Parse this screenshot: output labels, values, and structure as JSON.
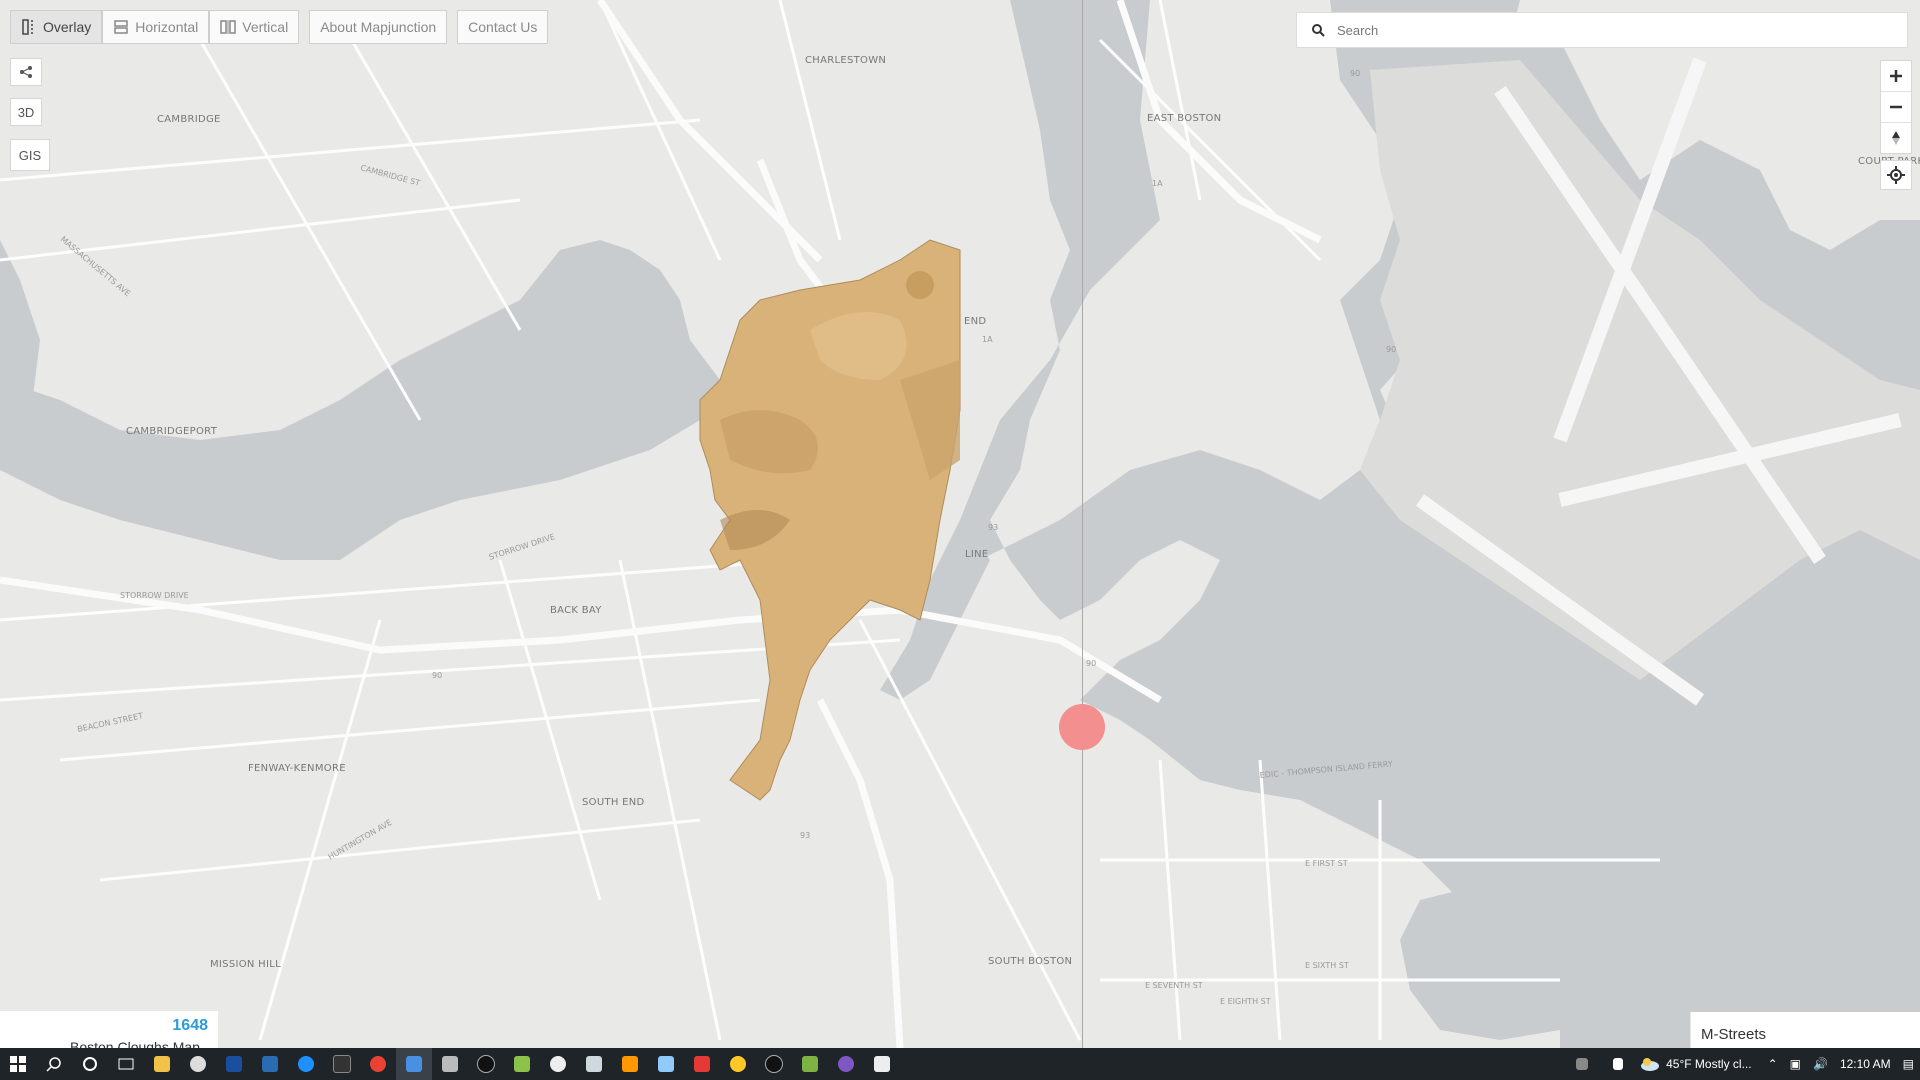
{
  "toolbar": {
    "overlay": "Overlay",
    "horizontal": "Horizontal",
    "vertical": "Vertical",
    "about": "About Mapjunction",
    "contact": "Contact Us"
  },
  "side_controls": {
    "three_d": "3D",
    "gis": "GIS"
  },
  "search": {
    "placeholder": "Search"
  },
  "map_labels": {
    "charlestown": "CHARLESTOWN",
    "east_boston": "EAST BOSTON",
    "cambridge": "CAMBRIDGE",
    "cambridgeport": "CAMBRIDGEPORT",
    "back_bay": "BACK BAY",
    "fenway": "FENWAY-KENMORE",
    "south_end": "SOUTH END",
    "mission_hill": "MISSION HILL",
    "south_boston": "SOUTH BOSTON",
    "court_park": "COURT PARK",
    "end": "END",
    "line": "LINE"
  },
  "road_labels": {
    "storrow_1": "STORROW DRIVE",
    "storrow_2": "STORROW DRIVE",
    "mass_ave": "MASSACHUSETTS AVE",
    "cambridge_st": "CAMBRIDGE ST",
    "beacon_st": "BEACON STREET",
    "huntington": "HUNTINGTON AVE",
    "e_first": "E FIRST ST",
    "e_sixth": "E SIXTH ST",
    "e_seventh": "E SEVENTH ST",
    "e_eighth": "E EIGHTH ST",
    "ferry": "EDIC - THOMPSON ISLAND FERRY",
    "r_90a": "90",
    "r_90b": "90",
    "r_90c": "90",
    "r_90d": "90",
    "r_93a": "93",
    "r_93b": "93",
    "r_1a": "1A",
    "r_1a2": "1A"
  },
  "info": {
    "year": "1648",
    "name": "Boston Cloughs Map"
  },
  "basemap": {
    "label": "M-Streets"
  },
  "taskbar": {
    "weather": "45°F  Mostly cl...",
    "time": "12:10 AM"
  },
  "colors": {
    "water": "#c9ccce",
    "land": "#e9e9e7",
    "handle": "#f38f8f",
    "year": "#2c9bd6",
    "historic_map": "#d9b27a"
  }
}
